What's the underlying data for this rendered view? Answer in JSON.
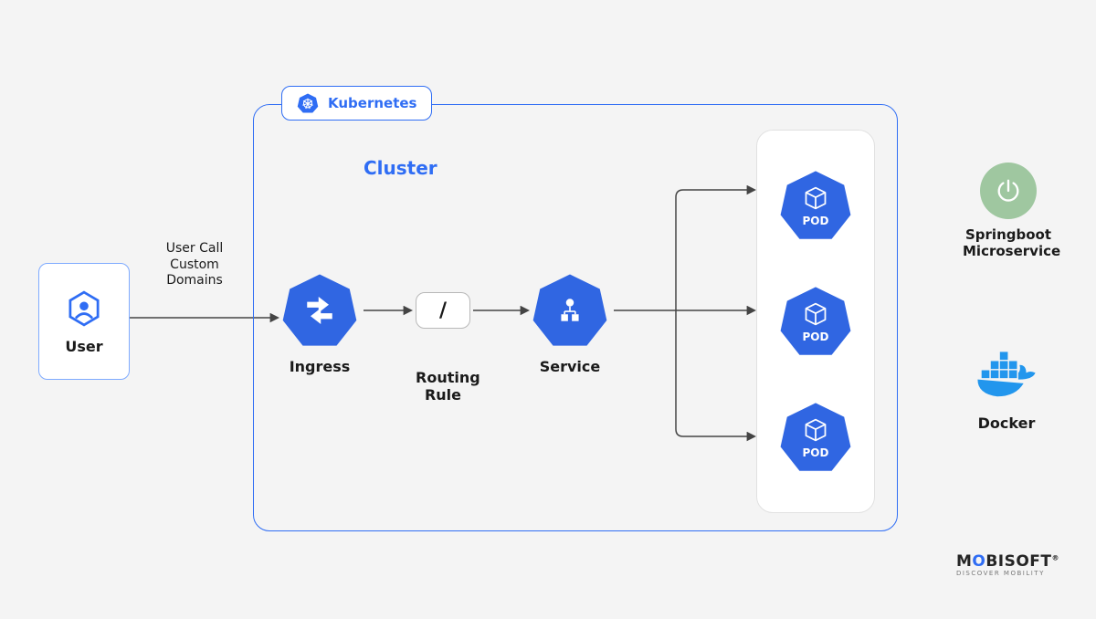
{
  "kubernetes_badge": "Kubernetes",
  "cluster_title": "Cluster",
  "user": {
    "label": "User"
  },
  "arrow_user_to_ingress": {
    "label_line1": "User Call",
    "label_line2": "Custom",
    "label_line3": "Domains"
  },
  "ingress": {
    "label": "Ingress"
  },
  "routing_rule": {
    "symbol": "/",
    "label": "Routing\nRule"
  },
  "service": {
    "label": "Service"
  },
  "pods": [
    {
      "label": "POD"
    },
    {
      "label": "POD"
    },
    {
      "label": "POD"
    }
  ],
  "springboot": {
    "label": "Springboot\nMicroservice"
  },
  "docker": {
    "label": "Docker"
  },
  "brand": {
    "name_prefix": "M",
    "name_mid": "O",
    "name_suffix": "BISOFT",
    "tagline": "DISCOVER MOBILITY",
    "registered": "®"
  },
  "colors": {
    "blue": "#2f6df4",
    "heptagon": "#3066e2",
    "spring": "#9fc7a0",
    "docker": "#2296ed"
  }
}
